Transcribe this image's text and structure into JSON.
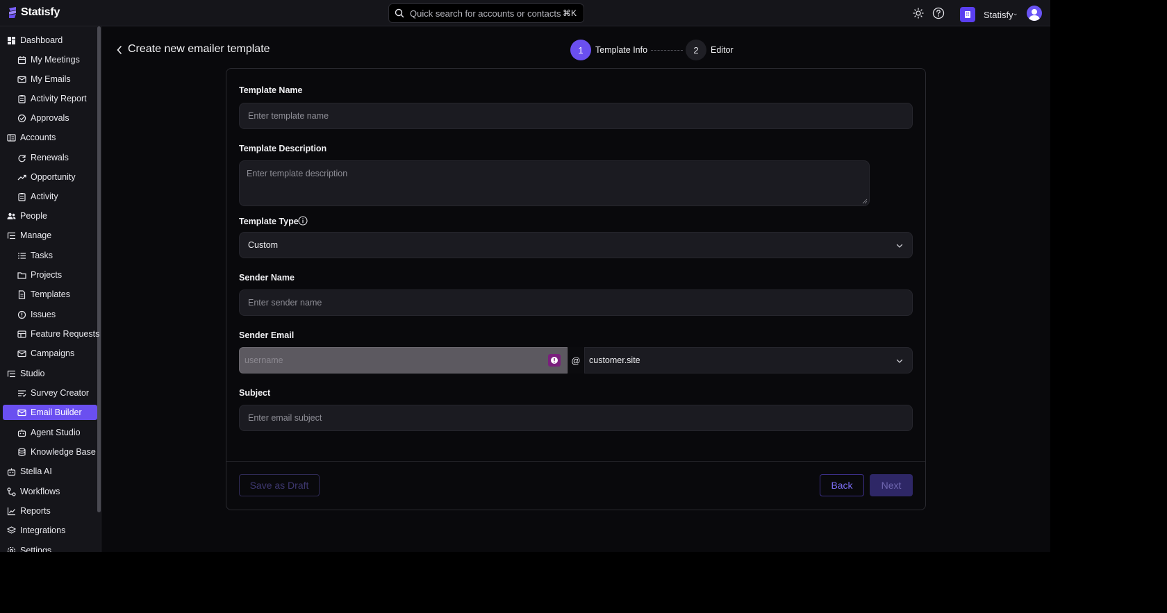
{
  "brand": {
    "name": "Statisfy"
  },
  "search": {
    "placeholder": "Quick search for accounts or contacts",
    "shortcut": "⌘K"
  },
  "org": {
    "name": "Statisfy",
    "caret": "⌄"
  },
  "sidebar": {
    "items": [
      {
        "label": "Dashboard"
      },
      {
        "label": "My Meetings"
      },
      {
        "label": "My Emails"
      },
      {
        "label": "Activity Report"
      },
      {
        "label": "Approvals"
      },
      {
        "label": "Accounts"
      },
      {
        "label": "Renewals"
      },
      {
        "label": "Opportunity"
      },
      {
        "label": "Activity"
      },
      {
        "label": "People"
      },
      {
        "label": "Manage"
      },
      {
        "label": "Tasks"
      },
      {
        "label": "Projects"
      },
      {
        "label": "Templates"
      },
      {
        "label": "Issues"
      },
      {
        "label": "Feature Requests"
      },
      {
        "label": "Campaigns"
      },
      {
        "label": "Studio"
      },
      {
        "label": "Survey Creator"
      },
      {
        "label": "Email Builder"
      },
      {
        "label": "Agent Studio"
      },
      {
        "label": "Knowledge Base"
      },
      {
        "label": "Stella AI"
      },
      {
        "label": "Workflows"
      },
      {
        "label": "Reports"
      },
      {
        "label": "Integrations"
      },
      {
        "label": "Settings"
      }
    ]
  },
  "page": {
    "title": "Create new emailer template"
  },
  "steps": [
    {
      "number": "1",
      "label": "Template Info"
    },
    {
      "number": "2",
      "label": "Editor"
    }
  ],
  "form": {
    "template_name": {
      "label": "Template Name",
      "placeholder": "Enter template name"
    },
    "template_description": {
      "label": "Template Description",
      "placeholder": "Enter template description"
    },
    "template_type": {
      "label": "Template Type",
      "value": "Custom"
    },
    "sender_name": {
      "label": "Sender Name",
      "placeholder": "Enter sender name"
    },
    "sender_email": {
      "label": "Sender Email",
      "username_placeholder": "username",
      "at": "@",
      "domain": "customer.site"
    },
    "subject": {
      "label": "Subject",
      "placeholder": "Enter email subject"
    }
  },
  "actions": {
    "save_draft": "Save as Draft",
    "back": "Back",
    "next": "Next"
  },
  "colors": {
    "accent": "#6a4ff0",
    "background": "#09090c",
    "surface": "#15151a",
    "input": "#1b1b21"
  }
}
